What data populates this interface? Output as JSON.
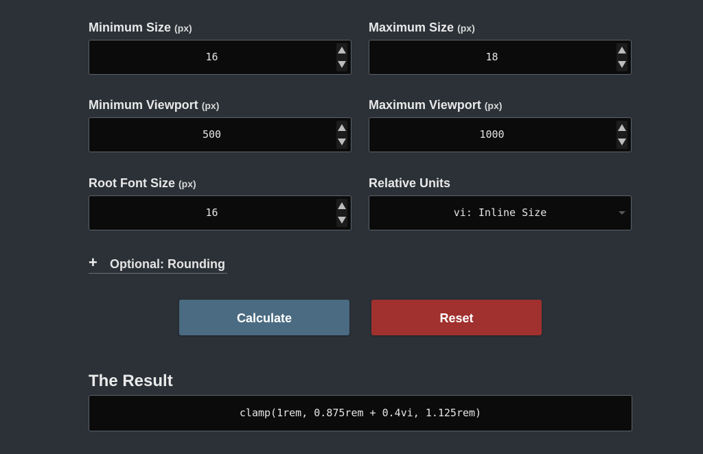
{
  "form": {
    "min_size": {
      "label": "Minimum Size",
      "unit": "(px)",
      "value": "16"
    },
    "max_size": {
      "label": "Maximum Size",
      "unit": "(px)",
      "value": "18"
    },
    "min_viewport": {
      "label": "Minimum Viewport",
      "unit": "(px)",
      "value": "500"
    },
    "max_viewport": {
      "label": "Maximum Viewport",
      "unit": "(px)",
      "value": "1000"
    },
    "root_font": {
      "label": "Root Font Size",
      "unit": "(px)",
      "value": "16"
    },
    "relative_units": {
      "label": "Relative Units",
      "selected": "vi: Inline Size"
    }
  },
  "optional": {
    "icon": "plus-icon",
    "label": "Optional: Rounding"
  },
  "buttons": {
    "calculate": {
      "label": "Calculate",
      "color": "#4a6b82"
    },
    "reset": {
      "label": "Reset",
      "color": "#a0312e"
    }
  },
  "result": {
    "title": "The Result",
    "value": "clamp(1rem, 0.875rem + 0.4vi, 1.125rem)"
  }
}
